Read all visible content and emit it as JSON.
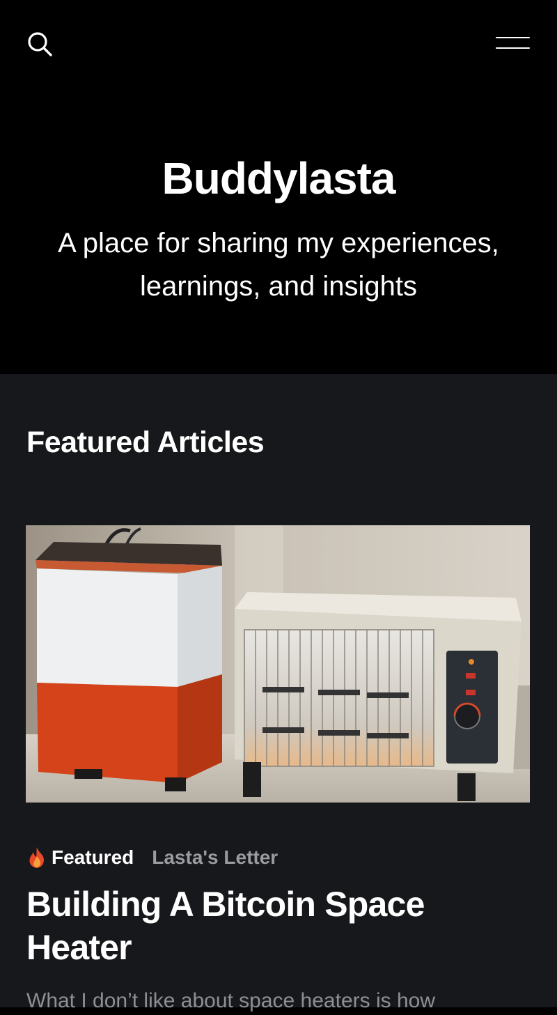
{
  "header": {
    "search_icon": "search-icon",
    "menu_icon": "hamburger-menu-icon"
  },
  "hero": {
    "title": "Buddylasta",
    "description": "A place for sharing my experiences, learnings, and insights"
  },
  "featured": {
    "section_title": "Featured Articles",
    "articles": [
      {
        "image_alt": "Orange and white bitcoin space heater next to a traditional electric heater",
        "tag_featured": "Featured",
        "tag_icon": "fire-icon",
        "category": "Lasta's Letter",
        "title": "Building A Bitcoin Space Heater",
        "excerpt": "What I don’t like about space heaters is how"
      }
    ]
  },
  "colors": {
    "hero_bg": "#000000",
    "content_bg": "#17181b",
    "text_primary": "#ffffff",
    "text_muted": "#9a9ca2"
  }
}
